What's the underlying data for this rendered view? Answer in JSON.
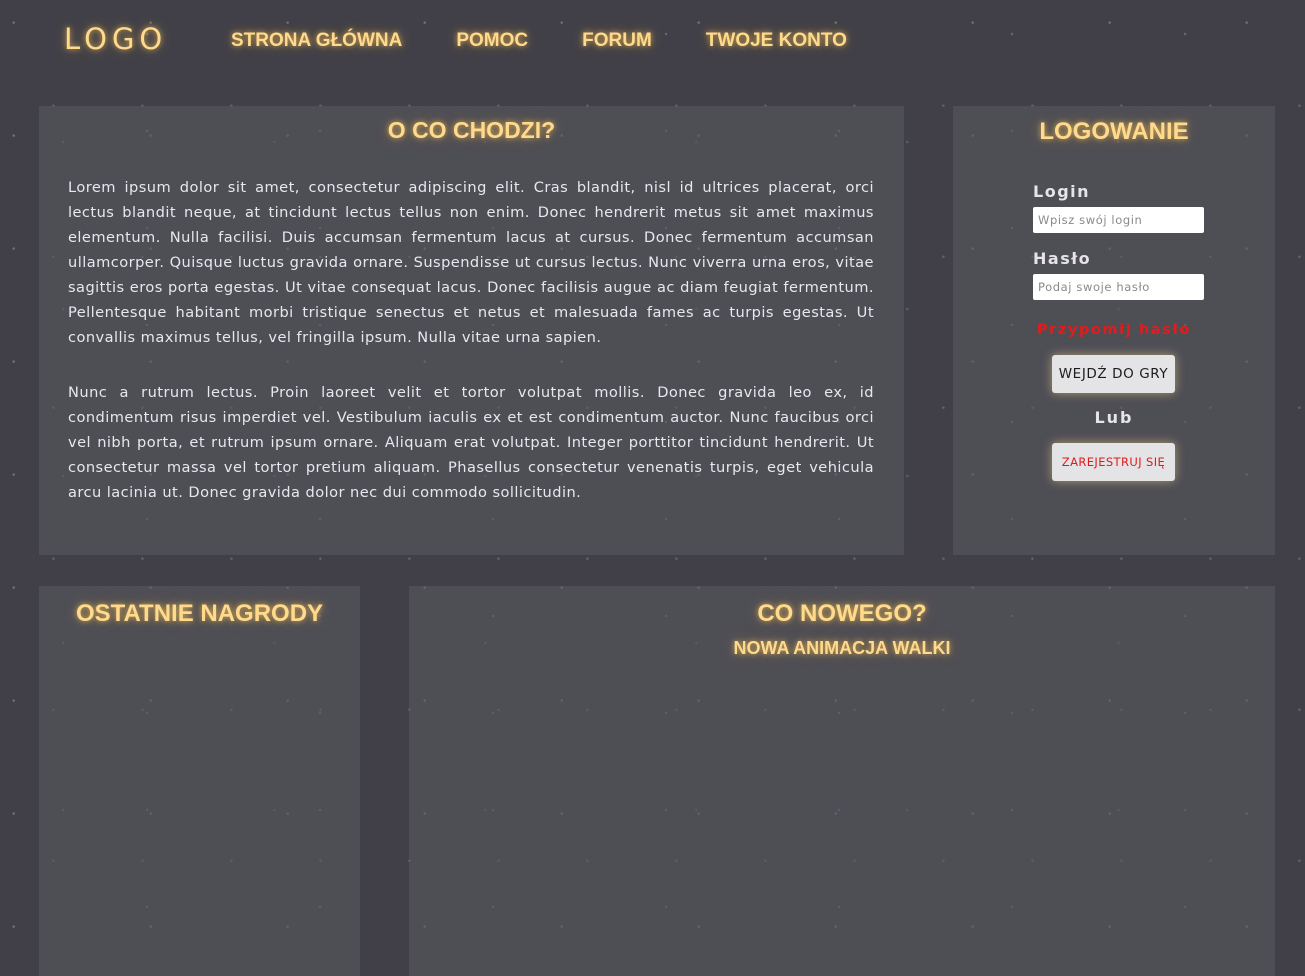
{
  "header": {
    "logo": "LOGO",
    "nav": [
      {
        "label": "STRONA GŁÓWNA"
      },
      {
        "label": "POMOC"
      },
      {
        "label": "FORUM"
      },
      {
        "label": "TWOJE KONTO"
      }
    ]
  },
  "about": {
    "title": "O CO CHODZI?",
    "paragraphs": [
      "Lorem ipsum dolor sit amet, consectetur adipiscing elit. Cras blandit, nisl id ultrices placerat, orci lectus blandit neque, at tincidunt lectus tellus non enim. Donec hendrerit metus sit amet maximus elementum. Nulla facilisi. Duis accumsan fermentum lacus at cursus. Donec fermentum accumsan ullamcorper. Quisque luctus gravida ornare. Suspendisse ut cursus lectus. Nunc viverra urna eros, vitae sagittis eros porta egestas. Ut vitae consequat lacus. Donec facilisis augue ac diam feugiat fermentum. Pellentesque habitant morbi tristique senectus et netus et malesuada fames ac turpis egestas. Ut convallis maximus tellus, vel fringilla ipsum. Nulla vitae urna sapien.",
      "Nunc a rutrum lectus. Proin laoreet velit et tortor volutpat mollis. Donec gravida leo ex, id condimentum risus imperdiet vel. Vestibulum iaculis ex et est condimentum auctor. Nunc faucibus orci vel nibh porta, et rutrum ipsum ornare. Aliquam erat volutpat. Integer porttitor tincidunt hendrerit. Ut consectetur massa vel tortor pretium aliquam. Phasellus consectetur venenatis turpis, eget vehicula arcu lacinia ut. Donec gravida dolor nec dui commodo sollicitudin."
    ]
  },
  "login": {
    "title": "LOGOWANIE",
    "login_label": "Login",
    "login_placeholder": "Wpisz swój login",
    "password_label": "Hasło",
    "password_placeholder": "Podaj swoje hasło",
    "remind_label": "Przypomij hasło",
    "enter_button": "WEJDŹ DO GRY",
    "or_label": "Lub",
    "register_button": "ZAREJESTRUJ SIĘ"
  },
  "awards": {
    "title": "OSTATNIE NAGRODY"
  },
  "news": {
    "title": "CO NOWEGO?",
    "subtitle": "NOWA ANIMACJA WALKI"
  },
  "colors": {
    "background": "#414048",
    "panel": "#55545b",
    "accent_glow": "#ffd98c",
    "danger": "#e41b1b"
  }
}
